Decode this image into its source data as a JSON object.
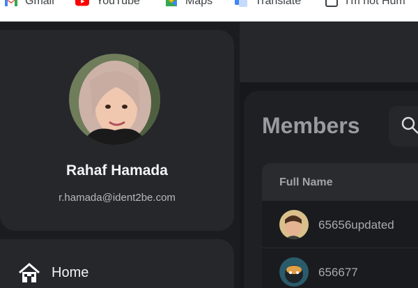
{
  "bookmarks": [
    {
      "label": "Gmail",
      "icon": "gmail-icon"
    },
    {
      "label": "YouTube",
      "icon": "youtube-icon"
    },
    {
      "label": "Maps",
      "icon": "maps-icon"
    },
    {
      "label": "Translate",
      "icon": "translate-icon"
    },
    {
      "label": "I'm not Hum",
      "icon": "checkbox-icon"
    }
  ],
  "profile": {
    "name": "Rahaf Hamada",
    "email": "r.hamada@ident2be.com"
  },
  "nav": {
    "home_label": "Home",
    "home_icon": "home-icon"
  },
  "members": {
    "title": "Members",
    "search_icon": "search-icon",
    "columns": [
      "Full Name"
    ],
    "rows": [
      {
        "full_name": "65656updated"
      },
      {
        "full_name": "656677"
      }
    ]
  },
  "colors": {
    "background": "#17181b",
    "card": "#26272b",
    "text_primary": "#f4f4f6",
    "text_muted": "#a9aab0"
  }
}
